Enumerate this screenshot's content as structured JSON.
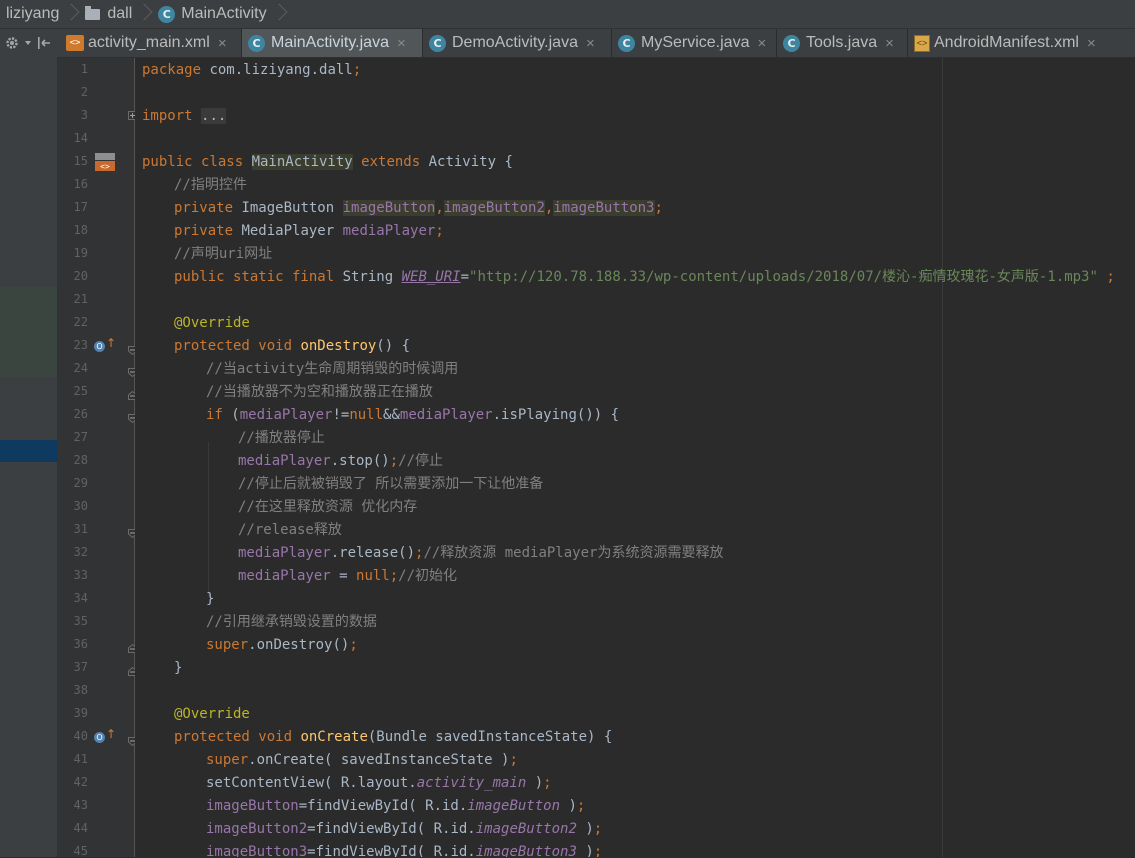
{
  "breadcrumb": {
    "items": [
      {
        "label": "liziyang",
        "icon": "none"
      },
      {
        "label": "dall",
        "icon": "folder-icon"
      },
      {
        "label": "MainActivity",
        "icon": "class-icon"
      }
    ]
  },
  "toolbar": {
    "settings_icon": "gear-icon",
    "collapse_icon": "collapse-icon"
  },
  "tabs": [
    {
      "label": "activity_main.xml",
      "icon": "xml-file-icon",
      "active": false
    },
    {
      "label": "MainActivity.java",
      "icon": "class-icon",
      "active": true
    },
    {
      "label": "DemoActivity.java",
      "icon": "class-icon",
      "active": false
    },
    {
      "label": "MyService.java",
      "icon": "class-icon",
      "active": false
    },
    {
      "label": "Tools.java",
      "icon": "class-icon",
      "active": false
    },
    {
      "label": "AndroidManifest.xml",
      "icon": "manifest-icon",
      "active": false
    }
  ],
  "tab_close_glyph": "×",
  "class_badge": "C",
  "editor": {
    "line_numbers": [
      "1",
      "2",
      "3",
      "14",
      "15",
      "16",
      "17",
      "18",
      "19",
      "20",
      "21",
      "22",
      "23",
      "24",
      "25",
      "26",
      "27",
      "28",
      "29",
      "30",
      "31",
      "32",
      "33",
      "34",
      "35",
      "36",
      "37",
      "38",
      "39",
      "40",
      "41",
      "42",
      "43",
      "44",
      "45"
    ],
    "code": {
      "package_kw": "package",
      "package_name": " com.liziyang.dall",
      "import_kw": "import",
      "import_fold": "...",
      "class_kw": "public class ",
      "class_name": "MainActivity",
      "extends_kw": " extends ",
      "class_tail": "Activity {",
      "c16": "//指明控件",
      "l17_kw": "private ",
      "l17_type": "ImageButton ",
      "l17_f1": "imageButton",
      "l17_f2": "imageButton2",
      "l17_f3": "imageButton3",
      "l18_kw": "private ",
      "l18_type": "MediaPlayer ",
      "l18_f": "mediaPlayer",
      "c19": "//声明uri网址",
      "l20_kw": "public static final ",
      "l20_type": "String ",
      "l20_f": "WEB_URI",
      "l20_eq": "=",
      "l20_str": "\"http://120.78.188.33/wp-content/uploads/2018/07/楼沁-痴情玫瑰花-女声版-1.mp3\"",
      "l20_tail": " ;",
      "ann": "@Override",
      "l23_kw": "protected void ",
      "l23_m": "onDestroy",
      "l23_tail": "() {",
      "c24": "//当activity生命周期销毁的时候调用",
      "c25": "//当播放器不为空和播放器正在播放",
      "l26_kw": "if ",
      "l26_p": "(",
      "l26_f1": "mediaPlayer",
      "l26_ne": "!=",
      "l26_null": "null",
      "l26_and": "&&",
      "l26_f2": "mediaPlayer",
      "l26_tail": ".isPlaying()) {",
      "c27": "//播放器停止",
      "l28_f": "mediaPlayer",
      "l28_call": ".stop()",
      "l28_c": "//停止",
      "c29": "//停止后就被销毁了 所以需要添加一下让他准备",
      "c30": "//在这里释放资源 优化内存",
      "c31": "//release释放",
      "l32_f": "mediaPlayer",
      "l32_call": ".release()",
      "l32_c": "//释放资源 mediaPlayer为系统资源需要释放",
      "l33_f": "mediaPlayer",
      "l33_eq": " = ",
      "l33_null": "null",
      "l33_c": "//初始化",
      "brace": "}",
      "c35": "//引用继承销毁设置的数据",
      "l36_super": "super",
      "l36_call": ".onDestroy()",
      "l40_kw": "protected void ",
      "l40_m": "onCreate",
      "l40_tail": "(Bundle savedInstanceState) {",
      "l41_super": "super",
      "l41_call": ".onCreate( savedInstanceState )",
      "l42_a": "setContentView( R.layout.",
      "l42_f": "activity_main",
      "l42_b": " )",
      "l43_f": "imageButton",
      "l43_a": "=findViewById( R.id.",
      "l43_fi": "imageButton",
      "l43_b": " )",
      "l44_f": "imageButton2",
      "l44_a": "=findViewById( R.id.",
      "l44_fi": "imageButton2",
      "l44_b": " )",
      "l45_f": "imageButton3",
      "l45_a": "=findViewById( R.id.",
      "l45_fi": "imageButton3",
      "l45_b": " )",
      "semi": ";",
      "comma": ","
    }
  },
  "colors": {
    "keyword": "#cc7832",
    "field": "#9876aa",
    "method": "#ffc66d",
    "comment": "#808080",
    "string": "#6a8759",
    "annotation": "#bbb529",
    "text": "#a9b7c6"
  }
}
